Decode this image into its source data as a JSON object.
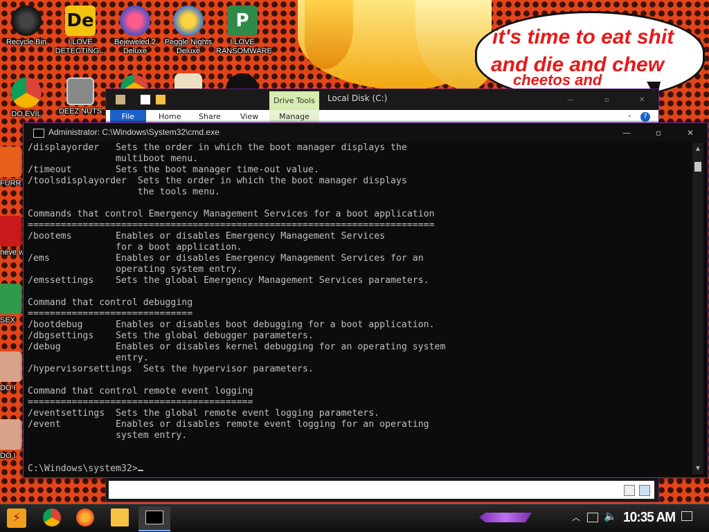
{
  "wallpaper": {
    "bubble_lines": [
      "it's time to eat shit",
      "and die and chew",
      "cheetos and"
    ],
    "accent": "#e2451a"
  },
  "desktop_icons": [
    {
      "name": "recycle-bin",
      "label": "Recycle Bin"
    },
    {
      "name": "i-love-detecting",
      "label": "I LOVE DETECTING..."
    },
    {
      "name": "bejeweled",
      "label": "Bejeweled 2 Deluxe"
    },
    {
      "name": "peggle",
      "label": "Peggle Nights Deluxe"
    },
    {
      "name": "i-love-ransomware",
      "label": "I LOVE RANSOMWARE"
    },
    {
      "name": "do-evil",
      "label": "DO EVIL"
    },
    {
      "name": "deez-nuts",
      "label": "DEEZ NUTS"
    },
    {
      "name": "furr",
      "label": "FURR"
    },
    {
      "name": "never-why",
      "label": "neve why"
    },
    {
      "name": "sex",
      "label": "SEX"
    },
    {
      "name": "do-1",
      "label": "DO I"
    },
    {
      "name": "do-2",
      "label": "DO I"
    }
  ],
  "explorer": {
    "context_tab": "Drive Tools",
    "title": "Local Disk (C:)",
    "tabs": [
      "File",
      "Home",
      "Share",
      "View",
      "Manage"
    ]
  },
  "cmd": {
    "title": "Administrator: C:\\Windows\\System32\\cmd.exe",
    "lines": [
      "/displayorder   Sets the order in which the boot manager displays the",
      "                multiboot menu.",
      "/timeout        Sets the boot manager time-out value.",
      "/toolsdisplayorder  Sets the order in which the boot manager displays",
      "                    the tools menu.",
      "",
      "Commands that control Emergency Management Services for a boot application",
      "==========================================================================",
      "/bootems        Enables or disables Emergency Management Services",
      "                for a boot application.",
      "/ems            Enables or disables Emergency Management Services for an",
      "                operating system entry.",
      "/emssettings    Sets the global Emergency Management Services parameters.",
      "",
      "Command that control debugging",
      "==============================",
      "/bootdebug      Enables or disables boot debugging for a boot application.",
      "/dbgsettings    Sets the global debugger parameters.",
      "/debug          Enables or disables kernel debugging for an operating system",
      "                entry.",
      "/hypervisorsettings  Sets the hypervisor parameters.",
      "",
      "Command that control remote event logging",
      "=========================================",
      "/eventsettings  Sets the global remote event logging parameters.",
      "/event          Enables or disables remote event logging for an operating",
      "                system entry.",
      "",
      ""
    ],
    "prompt": "C:\\Windows\\system32>"
  },
  "taskbar": {
    "clock": "10:35 AM",
    "pinned": [
      "chrome-icon",
      "firefox-icon",
      "file-explorer-icon",
      "cmd-icon"
    ]
  }
}
